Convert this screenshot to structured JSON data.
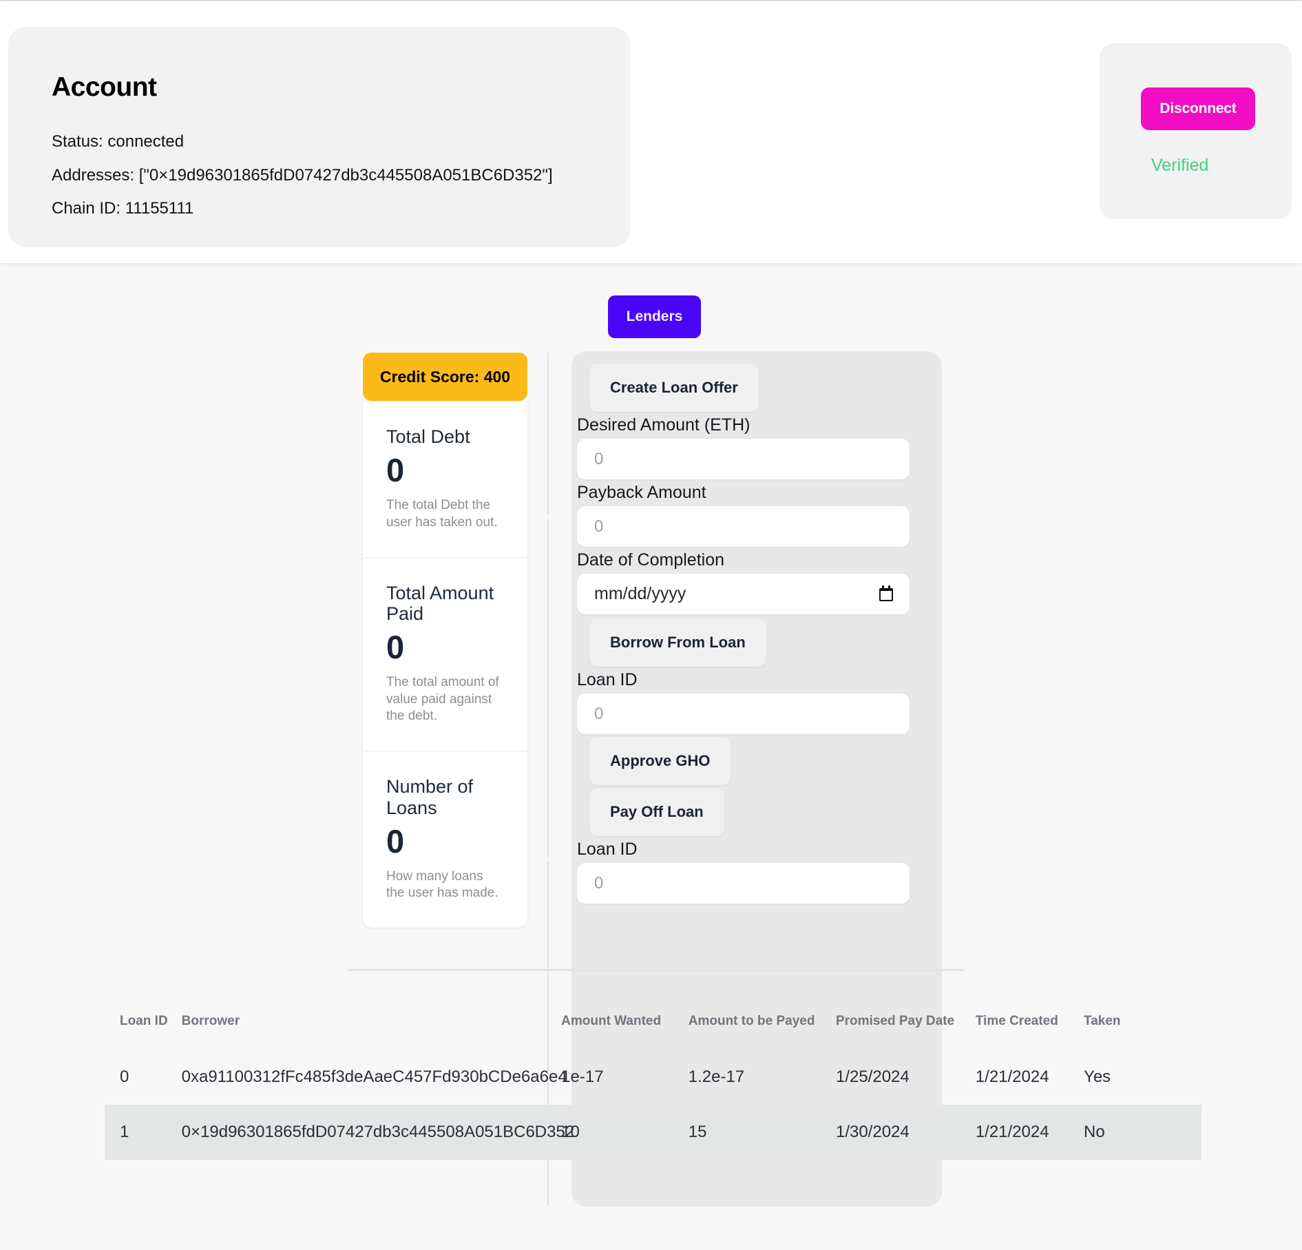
{
  "header": {
    "account": {
      "title": "Account",
      "status_line": "Status: connected",
      "addresses_line": "Addresses: [\"0×19d96301865fdD07427db3c445508A051BC6D352\"]",
      "chain_line": "Chain ID: 11155111"
    },
    "wallet": {
      "disconnect_label": "Disconnect",
      "verified_label": "Verified",
      "disconnect_color": "#f20cc4",
      "verified_color": "#3ed17e"
    }
  },
  "main": {
    "lenders_tab_label": "Lenders",
    "lenders_tab_color": "#4a06f7"
  },
  "stats": {
    "credit_badge_label": "Credit Score: 400",
    "credit_badge_color": "#fcba18",
    "items": [
      {
        "title": "Total Debt",
        "value": "0",
        "desc": "The total Debt the user has taken out."
      },
      {
        "title": "Total Amount Paid",
        "value": "0",
        "desc": "The total amount of value paid against the debt."
      },
      {
        "title": "Number of Loans",
        "value": "0",
        "desc": "How many loans the user has made."
      }
    ]
  },
  "form": {
    "create_loan_offer_label": "Create Loan Offer",
    "desired_amount_label": "Desired Amount (ETH)",
    "desired_amount_value": "",
    "desired_amount_placeholder": "0",
    "payback_amount_label": "Payback Amount",
    "payback_amount_value": "",
    "payback_amount_placeholder": "0",
    "date_of_completion_label": "Date of Completion",
    "date_of_completion_value": "mm/dd/yyyy",
    "borrow_from_loan_label": "Borrow From Loan",
    "borrow_loan_id_label": "Loan ID",
    "borrow_loan_id_value": "",
    "borrow_loan_id_placeholder": "0",
    "approve_gho_label": "Approve GHO",
    "pay_off_loan_label": "Pay Off Loan",
    "payoff_loan_id_label": "Loan ID",
    "payoff_loan_id_value": "",
    "payoff_loan_id_placeholder": "0"
  },
  "table": {
    "columns": [
      "Loan ID",
      "Borrower",
      "Amount Wanted",
      "Amount to be Payed",
      "Promised Pay Date",
      "Time Created",
      "Taken"
    ],
    "rows": [
      {
        "loan_id": "0",
        "borrower": "0xa91100312fFc485f3deAaeC457Fd930bCDe6a6e4",
        "amount_wanted": "1e-17",
        "amount_to_be_payed": "1.2e-17",
        "promised_pay_date": "1/25/2024",
        "time_created": "1/21/2024",
        "taken": "Yes"
      },
      {
        "loan_id": "1",
        "borrower": "0×19d96301865fdD07427db3c445508A051BC6D352",
        "amount_wanted": "10",
        "amount_to_be_payed": "15",
        "promised_pay_date": "1/30/2024",
        "time_created": "1/21/2024",
        "taken": "No"
      }
    ]
  }
}
